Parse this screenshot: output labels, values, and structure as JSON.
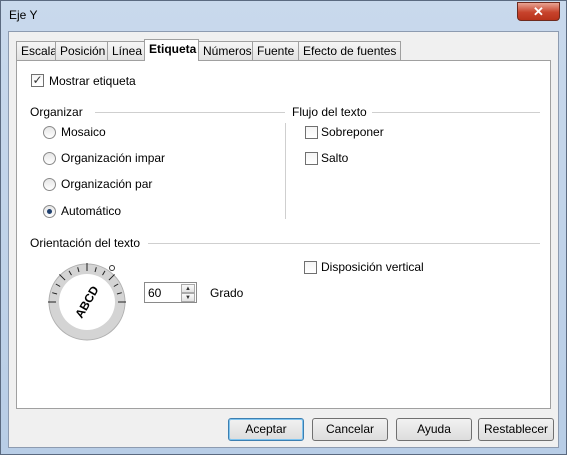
{
  "window": {
    "title": "Eje Y"
  },
  "tabs": [
    {
      "label": "Escala",
      "active": false
    },
    {
      "label": "Posición",
      "active": false
    },
    {
      "label": "Línea",
      "active": false
    },
    {
      "label": "Etiqueta",
      "active": true
    },
    {
      "label": "Números",
      "active": false
    },
    {
      "label": "Fuente",
      "active": false
    },
    {
      "label": "Efecto de fuentes",
      "active": false
    }
  ],
  "show_label": {
    "label": "Mostrar etiqueta",
    "checked": true
  },
  "organize": {
    "heading": "Organizar",
    "options": [
      {
        "label": "Mosaico",
        "selected": false
      },
      {
        "label": "Organización impar",
        "selected": false
      },
      {
        "label": "Organización par",
        "selected": false
      },
      {
        "label": "Automático",
        "selected": true
      }
    ]
  },
  "text_flow": {
    "heading": "Flujo del texto",
    "overlap": {
      "label": "Sobreponer",
      "checked": false
    },
    "break": {
      "label": "Salto",
      "checked": false
    }
  },
  "orientation": {
    "heading": "Orientación del texto",
    "dial_text": "ABCD",
    "degrees_value": "60",
    "degrees_label": "Grado",
    "vertical": {
      "label": "Disposición vertical",
      "checked": false
    }
  },
  "buttons": {
    "ok": "Aceptar",
    "cancel": "Cancelar",
    "help": "Ayuda",
    "reset": "Restablecer"
  }
}
